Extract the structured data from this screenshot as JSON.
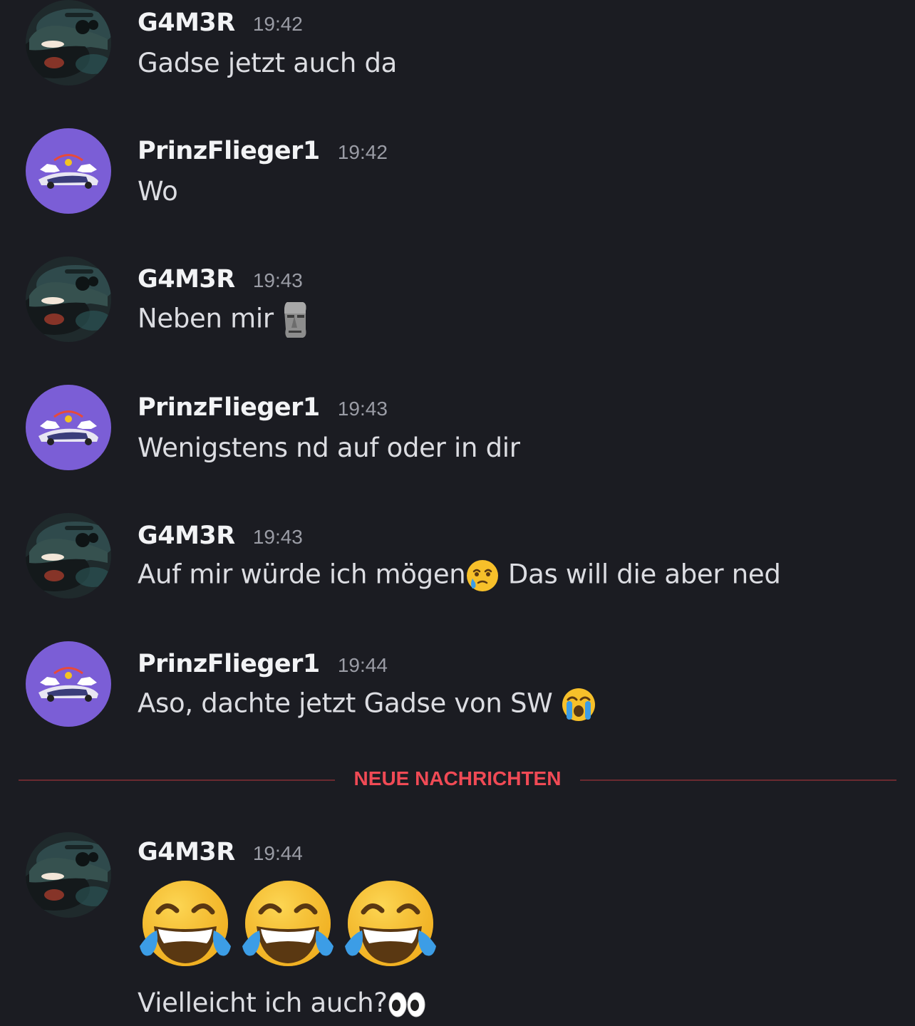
{
  "messages": [
    {
      "author": "G4M3R",
      "time": "19:42",
      "text": "Gadse jetzt auch da",
      "avatar": "car-dark-avatar"
    },
    {
      "author": "PrinzFlieger1",
      "time": "19:42",
      "text": "Wo",
      "avatar": "redbull-purple-avatar"
    },
    {
      "author": "G4M3R",
      "time": "19:43",
      "text": "Neben mir ",
      "emoji": "moai-emoji",
      "avatar": "car-dark-avatar"
    },
    {
      "author": "PrinzFlieger1",
      "time": "19:43",
      "text": "Wenigstens nd auf oder in dir",
      "avatar": "redbull-purple-avatar"
    },
    {
      "author": "G4M3R",
      "time": "19:43",
      "text_before": "Auf mir würde ich mögen",
      "emoji": "face-holding-back-tears-emoji",
      "text_after": " Das will die aber ned",
      "avatar": "car-dark-avatar"
    },
    {
      "author": "PrinzFlieger1",
      "time": "19:44",
      "text": "Aso, dachte jetzt Gadse von SW ",
      "emoji": "loudly-crying-face-emoji",
      "avatar": "redbull-purple-avatar"
    }
  ],
  "divider": {
    "label": "NEUE NACHRICHTEN",
    "color": "#f04a55"
  },
  "new_message": {
    "author": "G4M3R",
    "time": "19:44",
    "jumbo_emojis": [
      "face-with-tears-of-joy-emoji",
      "face-with-tears-of-joy-emoji",
      "face-with-tears-of-joy-emoji"
    ],
    "text": "Vielleicht ich auch?",
    "emoji": "eyes-emoji",
    "avatar": "car-dark-avatar"
  },
  "colors": {
    "background": "#1b1c22",
    "avatar_purple": "#7b5ed6",
    "author": "#f2f3f5",
    "timestamp": "#9a9ca5"
  }
}
